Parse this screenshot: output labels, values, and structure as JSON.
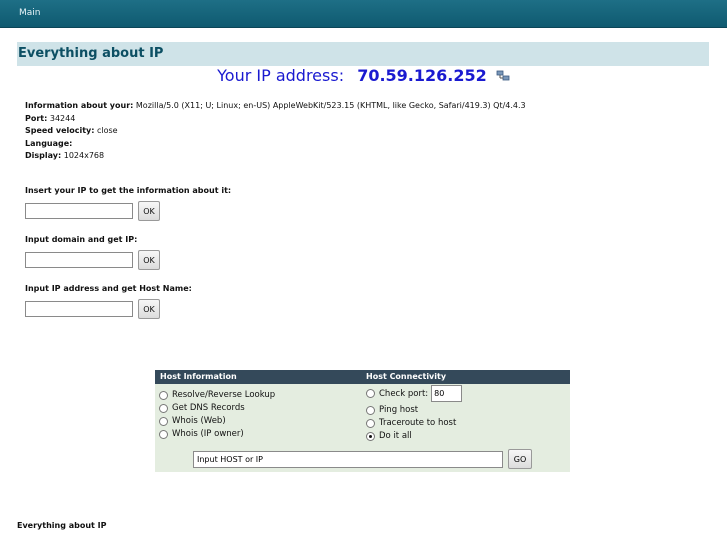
{
  "topbar": {
    "nav_main": "Main"
  },
  "heading": {
    "title": "Everything about IP"
  },
  "ip": {
    "label": "Your IP address:",
    "value": "70.59.126.252",
    "icon": "network-icon"
  },
  "info": {
    "agent_label": "Information about your:",
    "agent_value": "Mozilla/5.0 (X11; U; Linux; en-US) AppleWebKit/523.15 (KHTML, like Gecko, Safari/419.3) Qt/4.4.3",
    "port_label": "Port:",
    "port_value": "34244",
    "speed_label": "Speed velocity:",
    "speed_value": "close",
    "language_label": "Language:",
    "language_value": "",
    "display_label": "Display:",
    "display_value": "1024x768"
  },
  "forms": {
    "ip_lookup_label": "Insert your IP to get the information about it:",
    "domain_label": "Input domain and get IP:",
    "hostname_label": "Input IP address and get Host Name:",
    "ok_label": "OK"
  },
  "tools": {
    "host_info_header": "Host Information",
    "host_conn_header": "Host Connectivity",
    "opt_resolve": "Resolve/Reverse Lookup",
    "opt_dns": "Get DNS Records",
    "opt_whois_web": "Whois (Web)",
    "opt_whois_owner": "Whois (IP owner)",
    "opt_check_port": "Check port:",
    "port_value": "80",
    "opt_ping": "Ping host",
    "opt_traceroute": "Traceroute to host",
    "opt_doitall": "Do it all",
    "host_input_value": "Input HOST or IP",
    "go_label": "GO"
  },
  "footer": {
    "text": "Everything about IP"
  }
}
